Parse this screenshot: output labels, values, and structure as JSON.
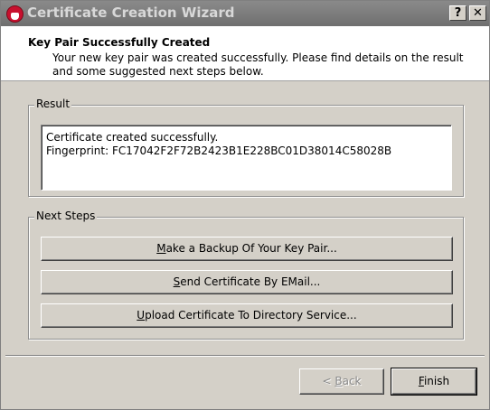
{
  "window": {
    "title": "Certificate Creation Wizard",
    "help_glyph": "?",
    "close_glyph": "✕"
  },
  "header": {
    "title": "Key Pair Successfully Created",
    "description": "Your new key pair was created successfully. Please find details on the result and some suggested next steps below."
  },
  "result": {
    "label": "Result",
    "line1": "Certificate created successfully.",
    "line2": "Fingerprint: FC17042F2F72B2423B1E228BC01D38014C58028B"
  },
  "next_steps": {
    "label": "Next Steps",
    "backup": {
      "mnemonic": "M",
      "rest": "ake a Backup Of Your Key Pair..."
    },
    "email": {
      "mnemonic": "S",
      "rest": "end Certificate By EMail..."
    },
    "upload": {
      "mnemonic": "U",
      "rest": "pload Certificate To Directory Service..."
    }
  },
  "footer": {
    "back": {
      "prefix": "< ",
      "mnemonic": "B",
      "rest": "ack",
      "enabled": false
    },
    "finish": {
      "mnemonic": "F",
      "rest": "inish"
    }
  }
}
